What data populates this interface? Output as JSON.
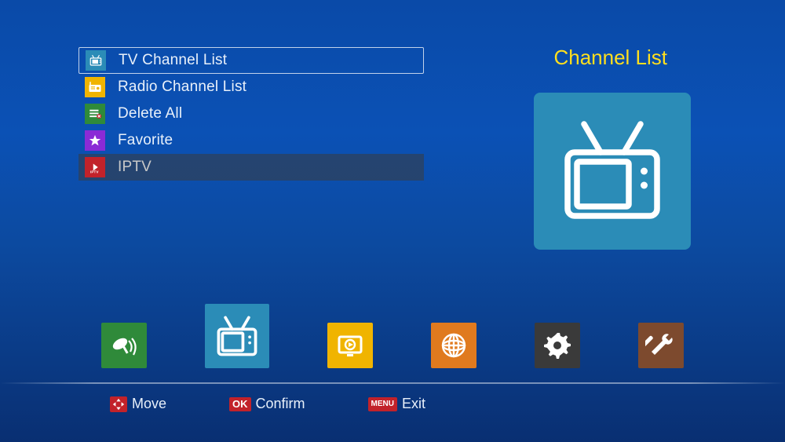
{
  "preview": {
    "title": "Channel List",
    "icon": "tv-icon"
  },
  "menu": {
    "items": [
      {
        "label": "TV Channel List",
        "icon": "tv-small-icon",
        "icon_bg": "#2b8cb7",
        "selected": true,
        "dim": false
      },
      {
        "label": "Radio Channel List",
        "icon": "radio-icon",
        "icon_bg": "#f0b400",
        "selected": false,
        "dim": false
      },
      {
        "label": "Delete All",
        "icon": "delete-all-icon",
        "icon_bg": "#2f8a3a",
        "selected": false,
        "dim": false
      },
      {
        "label": "Favorite",
        "icon": "star-icon",
        "icon_bg": "#8a2bd6",
        "selected": false,
        "dim": false
      },
      {
        "label": "IPTV",
        "icon": "iptv-icon",
        "icon_bg": "#c2222a",
        "selected": false,
        "dim": true
      }
    ]
  },
  "nav": {
    "tiles": [
      {
        "name": "satellite",
        "bg": "#2f8a3a",
        "active": false
      },
      {
        "name": "channel",
        "bg": "#2b8cb7",
        "active": true
      },
      {
        "name": "media",
        "bg": "#f0b400",
        "active": false
      },
      {
        "name": "network",
        "bg": "#e07a1e",
        "active": false
      },
      {
        "name": "settings",
        "bg": "#3a3a3a",
        "active": false
      },
      {
        "name": "tools",
        "bg": "#7d4a2e",
        "active": false
      }
    ]
  },
  "hints": {
    "move": {
      "badge": "arrows",
      "label": "Move"
    },
    "confirm": {
      "badge": "OK",
      "label": "Confirm"
    },
    "exit": {
      "badge": "MENU",
      "label": "Exit"
    }
  }
}
